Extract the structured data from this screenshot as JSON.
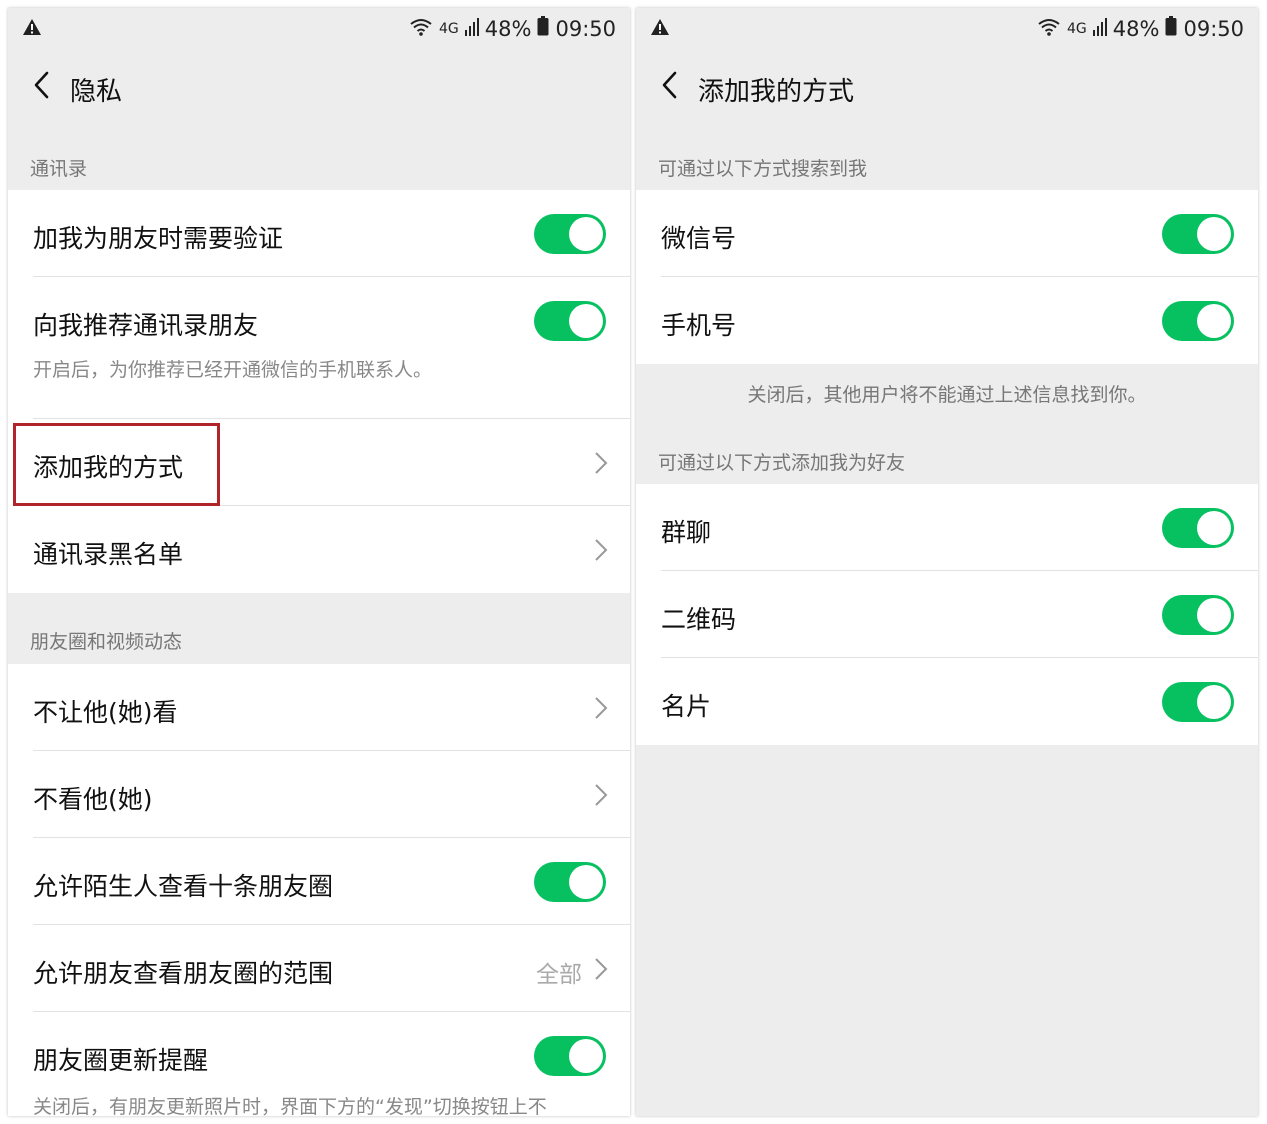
{
  "status_bar": {
    "network": "4G",
    "battery": "48%",
    "time": "09:50"
  },
  "privacy": {
    "title": "隐私",
    "contacts_header": "通讯录",
    "require_verification": "加我为朋友时需要验证",
    "recommend_contacts": "向我推荐通讯录朋友",
    "recommend_desc": "开启后，为你推荐已经开通微信的手机联系人。",
    "add_me_methods": "添加我的方式",
    "contacts_blacklist": "通讯录黑名单",
    "moments_header": "朋友圈和视频动态",
    "dont_let_see": "不让他(她)看",
    "dont_see": "不看他(她)",
    "allow_strangers": "允许陌生人查看十条朋友圈",
    "allow_friends_range": "允许朋友查看朋友圈的范围",
    "range_value": "全部",
    "moments_reminder": "朋友圈更新提醒",
    "reminder_desc": "关闭后，有朋友更新照片时，界面下方的“发现”切换按钮上不"
  },
  "add_methods": {
    "title": "添加我的方式",
    "search_header": "可通过以下方式搜索到我",
    "wechat_id": "微信号",
    "phone": "手机号",
    "search_note": "关闭后，其他用户将不能通过上述信息找到你。",
    "add_header": "可通过以下方式添加我为好友",
    "group_chat": "群聊",
    "qr_code": "二维码",
    "business_card": "名片"
  },
  "toggles": {
    "require_verification": true,
    "recommend_contacts": true,
    "allow_strangers": true,
    "moments_reminder": true,
    "wechat_id": true,
    "phone": true,
    "group_chat": true,
    "qr_code": true,
    "business_card": true
  },
  "colors": {
    "accent": "#07c160",
    "highlight": "#b0242a",
    "background": "#ededed"
  }
}
